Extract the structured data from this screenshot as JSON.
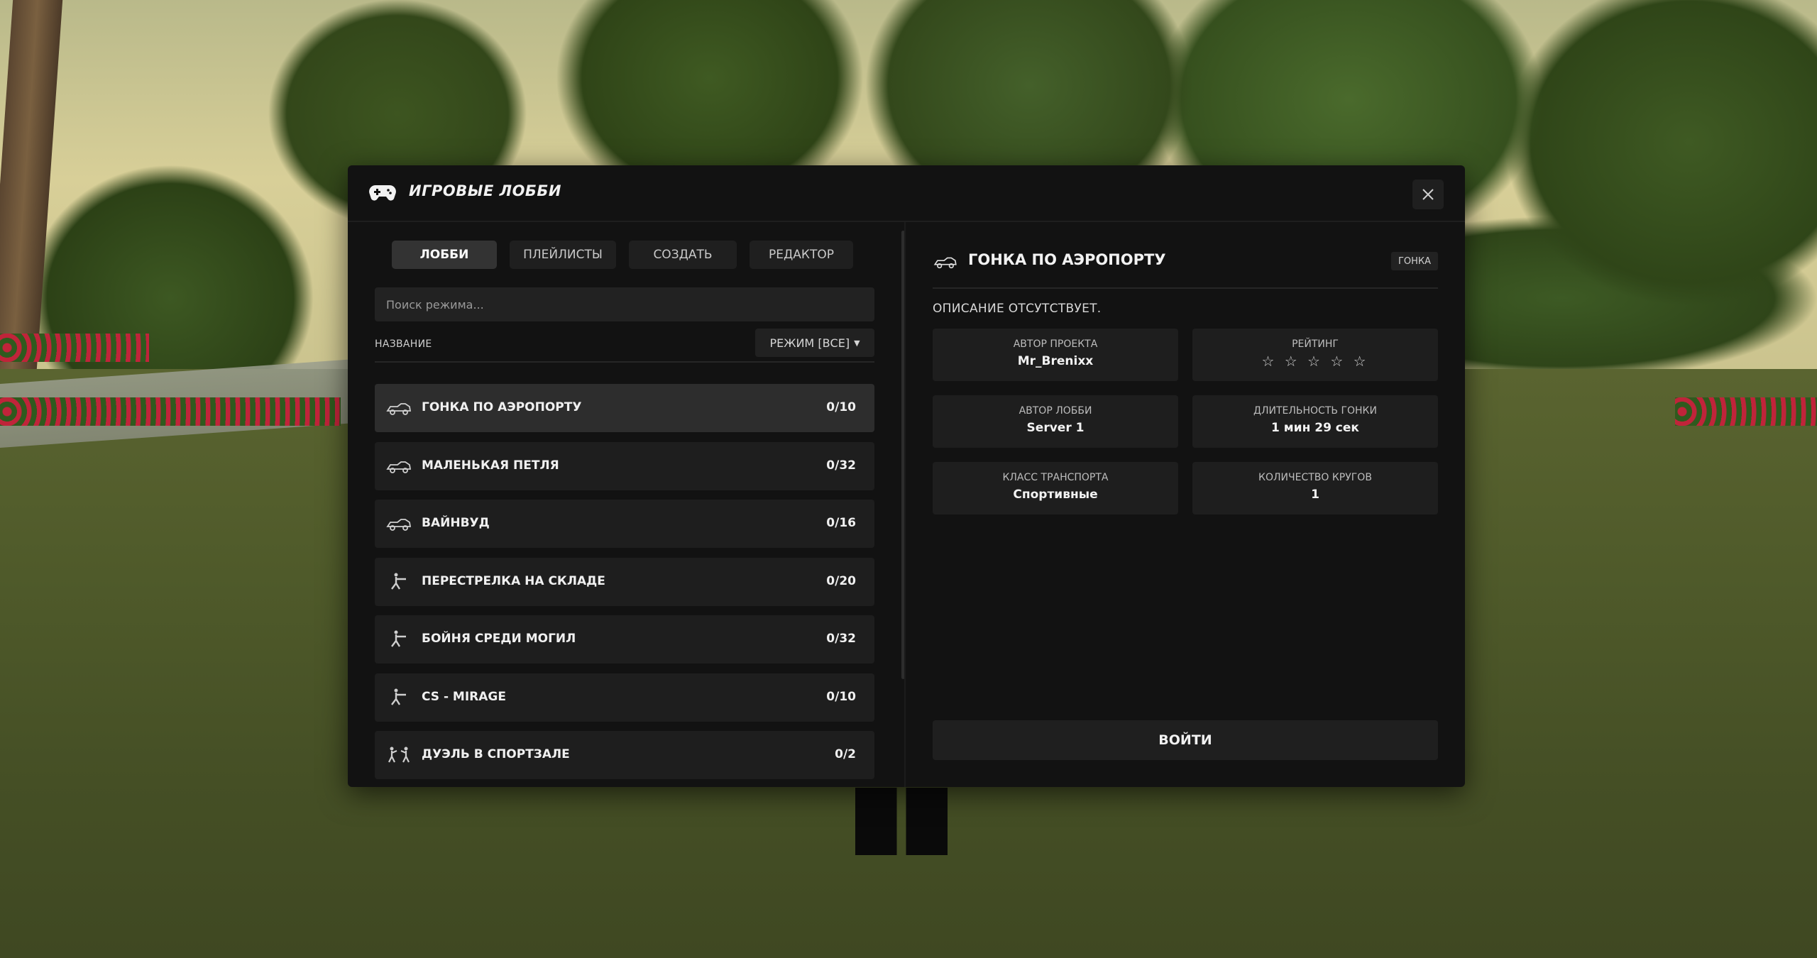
{
  "window": {
    "title": "ИГРОВЫЕ ЛОББИ",
    "title_icon": "gamepad-icon",
    "close_icon": "close-icon"
  },
  "tabs": [
    {
      "label": "ЛОББИ",
      "active": true
    },
    {
      "label": "ПЛЕЙЛИСТЫ",
      "active": false
    },
    {
      "label": "СОЗДАТЬ",
      "active": false
    },
    {
      "label": "РЕДАКТОР",
      "active": false
    }
  ],
  "search": {
    "placeholder": "Поиск режима...",
    "value": ""
  },
  "list_header": {
    "name_label": "НАЗВАНИЕ",
    "mode_filter": "РЕЖИМ [ВСЕ]",
    "mode_filter_icon": "caret-down-icon"
  },
  "lobbies": [
    {
      "icon": "race-car-icon",
      "name": "ГОНКА ПО АЭРОПОРТУ",
      "players": "0/10",
      "selected": true
    },
    {
      "icon": "race-car-icon",
      "name": "МАЛЕНЬКАЯ ПЕТЛЯ",
      "players": "0/32",
      "selected": false
    },
    {
      "icon": "race-car-icon",
      "name": "ВАЙНВУД",
      "players": "0/16",
      "selected": false
    },
    {
      "icon": "shooter-icon",
      "name": "ПЕРЕСТРЕЛКА НА СКЛАДЕ",
      "players": "0/20",
      "selected": false
    },
    {
      "icon": "shooter-icon",
      "name": "БОЙНЯ СРЕДИ МОГИЛ",
      "players": "0/32",
      "selected": false
    },
    {
      "icon": "shooter-icon",
      "name": "CS - MIRAGE",
      "players": "0/10",
      "selected": false
    },
    {
      "icon": "duel-icon",
      "name": "ДУЭЛЬ В СПОРТЗАЛЕ",
      "players": "0/2",
      "selected": false
    }
  ],
  "detail": {
    "icon": "race-car-icon",
    "title": "ГОНКА ПО АЭРОПОРТУ",
    "type_badge": "ГОНКА",
    "description": "ОПИСАНИЕ ОТСУТСТВУЕТ.",
    "stats": {
      "project_author": {
        "label": "АВТОР ПРОЕКТА",
        "value": "Mr_Brenixx"
      },
      "rating": {
        "label": "РЕЙТИНГ",
        "stars": "☆ ☆ ☆ ☆ ☆",
        "rating_value": 0,
        "rating_max": 5
      },
      "lobby_author": {
        "label": "АВТОР ЛОББИ",
        "value": "Server 1"
      },
      "race_duration": {
        "label": "ДЛИТЕЛЬНОСТЬ ГОНКИ",
        "value": "1 мин 29 сек"
      },
      "vehicle_class": {
        "label": "КЛАСС ТРАНСПОРТА",
        "value": "Спортивные"
      },
      "laps": {
        "label": "КОЛИЧЕСТВО КРУГОВ",
        "value": "1"
      }
    },
    "enter_button": "ВОЙТИ"
  },
  "colors": {
    "panel": "#121212",
    "row": "#1e1e1e",
    "row_selected": "#2d2d2d",
    "text": "#f0f0f0"
  }
}
